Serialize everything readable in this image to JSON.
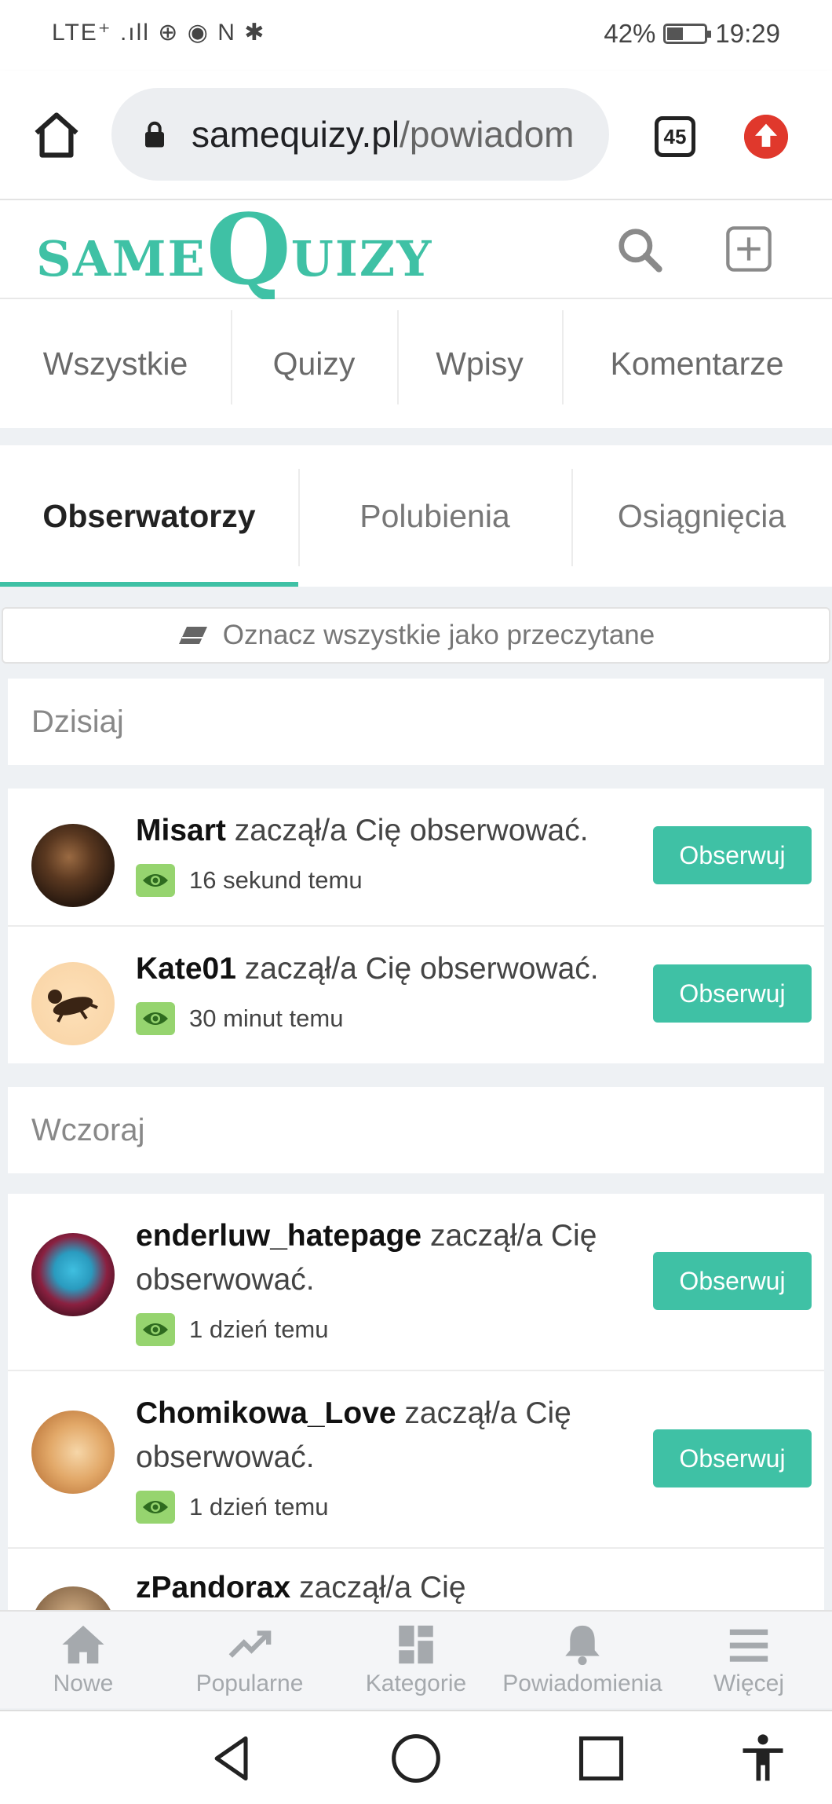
{
  "status_bar": {
    "signal_text": "LTE⁺ .ıll ⊕ ◉ N ✱",
    "battery_percent": "42%",
    "battery_level": 0.42,
    "time": "19:29"
  },
  "browser": {
    "url_domain": "samequizy.pl",
    "url_path": "/powiadom",
    "tab_count": "45"
  },
  "site": {
    "logo_small": "SAME",
    "logo_big": "Q",
    "logo_rest": "UIZY",
    "accent_color": "#3fc1a5"
  },
  "filters": [
    "Wszystkie",
    "Quizy",
    "Wpisy",
    "Komentarze"
  ],
  "notif_tabs": [
    {
      "label": "Obserwatorzy",
      "active": true
    },
    {
      "label": "Polubienia",
      "active": false
    },
    {
      "label": "Osiągnięcia",
      "active": false
    }
  ],
  "mark_all_read": "Oznacz wszystkie jako przeczytane",
  "sections": [
    {
      "label": "Dzisiaj",
      "items": [
        {
          "user": "Misart",
          "action": "zaczął/a Cię obserwować.",
          "time": "16 sekund temu",
          "button": "Obserwuj"
        },
        {
          "user": "Kate01",
          "action": "zaczął/a Cię obserwować.",
          "time": "30 minut temu",
          "button": "Obserwuj"
        }
      ]
    },
    {
      "label": "Wczoraj",
      "items": [
        {
          "user": "enderluw_hatepage",
          "action": "zaczął/a Cię obserwować.",
          "time": "1 dzień temu",
          "button": "Obserwuj"
        },
        {
          "user": "Chomikowa_Love",
          "action": "zaczął/a Cię obserwować.",
          "time": "1 dzień temu",
          "button": "Obserwuj"
        },
        {
          "user": "zPandorax",
          "action": "zaczął/a Cię",
          "time": "",
          "button": ""
        }
      ]
    }
  ],
  "bottom_nav": [
    "Nowe",
    "Popularne",
    "Kategorie",
    "Powiadomienia",
    "Więcej"
  ],
  "icons": {
    "home": "home-icon",
    "lock": "lock-icon",
    "search": "search-icon",
    "add": "plus-square-icon",
    "eraser": "eraser-icon",
    "eye": "eye-icon",
    "trending": "trending-up-icon",
    "categories": "grid-icon",
    "bell": "bell-icon",
    "menu": "menu-icon"
  }
}
